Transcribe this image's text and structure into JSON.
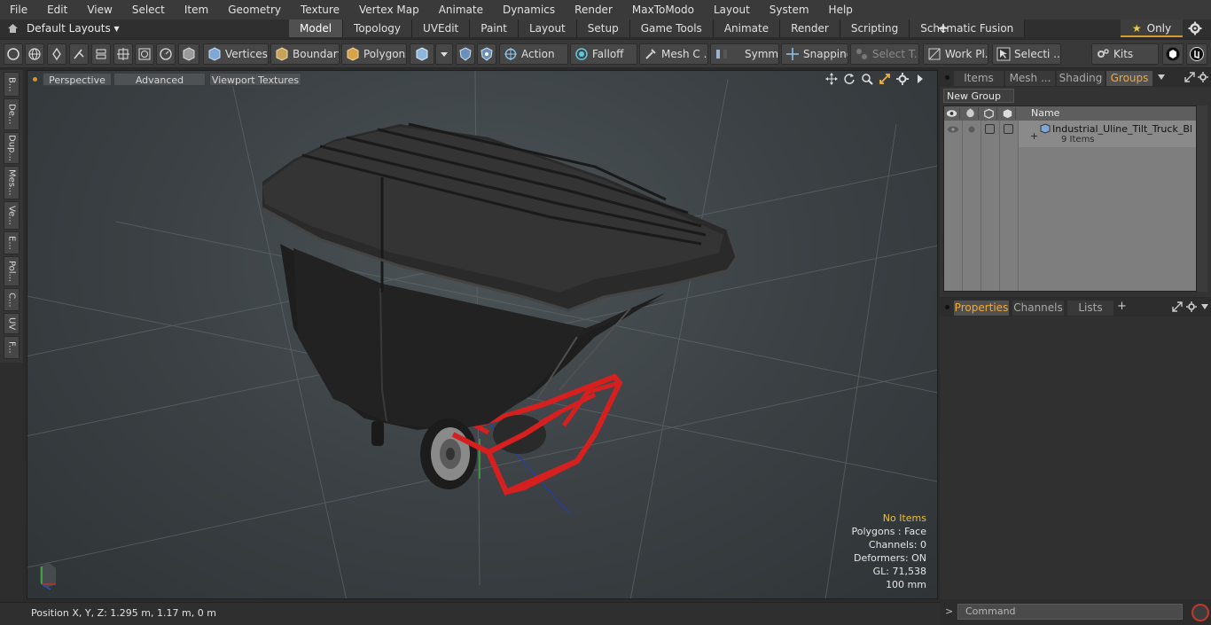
{
  "menu": [
    "File",
    "Edit",
    "View",
    "Select",
    "Item",
    "Geometry",
    "Texture",
    "Vertex Map",
    "Animate",
    "Dynamics",
    "Render",
    "MaxToModo",
    "Layout",
    "System",
    "Help"
  ],
  "layout_selector": "Default Layouts ▾",
  "tabs": [
    "Model",
    "Topology",
    "UVEdit",
    "Paint",
    "Layout",
    "Setup",
    "Game Tools",
    "Animate",
    "Render",
    "Scripting",
    "Schematic Fusion"
  ],
  "active_tab": "Model",
  "tab_add": "+",
  "only_label": "Only",
  "toolbar": {
    "vertices": "Vertices",
    "boundary": "Boundary",
    "polygons": "Polygons",
    "action": "Action",
    "falloff": "Falloff",
    "mesh": "Mesh C ...",
    "symm": "Symm ...",
    "snapping": "Snapping",
    "select_t": "Select T...",
    "work_pl": "Work Pl...",
    "selecti": "Selecti ...",
    "kits": "Kits"
  },
  "left_tabs": [
    "B...",
    "De...",
    "Dup...",
    "Mes...",
    "Ve...",
    "E...",
    "Pol...",
    "C...",
    "UV",
    "F..."
  ],
  "viewport": {
    "perspective": "Perspective",
    "advanced": "Advanced",
    "viewport_textures": "Viewport Textures",
    "info": {
      "no_items": "No Items",
      "polygons": "Polygons : Face",
      "channels": "Channels: 0",
      "deformers": "Deformers: ON",
      "gl": "GL: 71,538",
      "scale": "100 mm"
    }
  },
  "status": {
    "position": "Position X, Y, Z:   1.295 m, 1.17 m, 0 m"
  },
  "right_top": {
    "tabs": [
      "Items",
      "Mesh ...",
      "Shading",
      "Groups"
    ],
    "active_tab": "Groups",
    "new_group": "New Group",
    "name_header": "Name",
    "group_name": "Industrial_Uline_Tilt_Truck_Bl ...",
    "group_count": "9 Items"
  },
  "right_bottom": {
    "tabs": [
      "Properties",
      "Channels",
      "Lists"
    ],
    "active_tab": "Properties",
    "add": "+"
  },
  "command": {
    "placeholder": "Command",
    "arrow": ">"
  },
  "colors": {
    "accent": "#f2a93b",
    "cart_body": "#1e1e1e",
    "cart_frame": "#d62020"
  }
}
